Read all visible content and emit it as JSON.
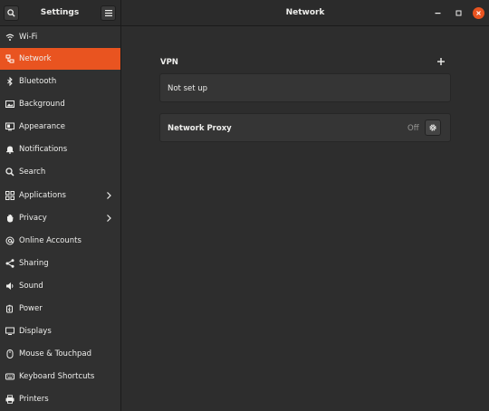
{
  "header": {
    "sidebar_title": "Settings",
    "main_title": "Network"
  },
  "sidebar": {
    "items": [
      {
        "label": "Wi-Fi",
        "icon": "wifi-icon",
        "active": false,
        "chevron": false
      },
      {
        "label": "Network",
        "icon": "network-icon",
        "active": true,
        "chevron": false
      },
      {
        "label": "Bluetooth",
        "icon": "bluetooth-icon",
        "active": false,
        "chevron": false
      },
      {
        "label": "Background",
        "icon": "background-icon",
        "active": false,
        "chevron": false
      },
      {
        "label": "Appearance",
        "icon": "appearance-icon",
        "active": false,
        "chevron": false
      },
      {
        "label": "Notifications",
        "icon": "bell-icon",
        "active": false,
        "chevron": false
      },
      {
        "label": "Search",
        "icon": "search-icon",
        "active": false,
        "chevron": false
      },
      {
        "label": "Applications",
        "icon": "grid-icon",
        "active": false,
        "chevron": true
      },
      {
        "label": "Privacy",
        "icon": "hand-icon",
        "active": false,
        "chevron": true
      },
      {
        "label": "Online Accounts",
        "icon": "at-icon",
        "active": false,
        "chevron": false
      },
      {
        "label": "Sharing",
        "icon": "share-icon",
        "active": false,
        "chevron": false
      },
      {
        "label": "Sound",
        "icon": "speaker-icon",
        "active": false,
        "chevron": false
      },
      {
        "label": "Power",
        "icon": "power-icon",
        "active": false,
        "chevron": false
      },
      {
        "label": "Displays",
        "icon": "display-icon",
        "active": false,
        "chevron": false
      },
      {
        "label": "Mouse & Touchpad",
        "icon": "mouse-icon",
        "active": false,
        "chevron": false
      },
      {
        "label": "Keyboard Shortcuts",
        "icon": "keyboard-icon",
        "active": false,
        "chevron": false
      },
      {
        "label": "Printers",
        "icon": "printer-icon",
        "active": false,
        "chevron": false
      }
    ]
  },
  "main": {
    "vpn": {
      "title": "VPN",
      "status": "Not set up"
    },
    "proxy": {
      "label": "Network Proxy",
      "status": "Off"
    }
  },
  "colors": {
    "accent": "#e95420",
    "background": "#2d2d2d",
    "sidebar": "#303030",
    "text": "#eeeeec"
  }
}
